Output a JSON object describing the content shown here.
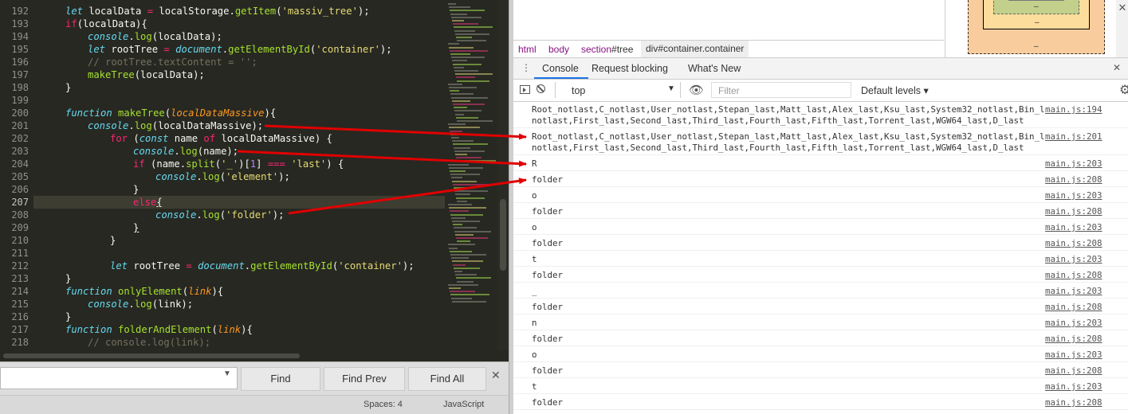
{
  "editor": {
    "line_numbers": [
      "192",
      "193",
      "194",
      "195",
      "196",
      "197",
      "198",
      "199",
      "200",
      "201",
      "202",
      "203",
      "204",
      "205",
      "206",
      "207",
      "208",
      "209",
      "210",
      "211",
      "212",
      "213",
      "214",
      "215",
      "216",
      "217",
      "218"
    ],
    "current_line": "207",
    "find_bar": {
      "input_value": "",
      "find_label": "Find",
      "find_prev_label": "Find Prev",
      "find_all_label": "Find All"
    },
    "status": {
      "spaces": "Spaces: 4",
      "syntax": "JavaScript"
    }
  },
  "devtools": {
    "breadcrumb": [
      {
        "tag": "html",
        "rest": ""
      },
      {
        "tag": "body",
        "rest": ""
      },
      {
        "tag": "section",
        "rest": "#tree"
      },
      {
        "tag": "div",
        "rest": "#container.container"
      }
    ],
    "box_model_dashes": [
      "–",
      "–",
      "–"
    ],
    "drawer_tabs": [
      "Console",
      "Request blocking",
      "What's New"
    ],
    "context": "top",
    "filter_placeholder": "Filter",
    "levels": "Default levels ▾",
    "messages": [
      {
        "text": "Root_notlast,C_notlast,User_notlast,Stepan_last,Matt_last,Alex_last,Ksu_last,System32_notlast,Bin_last,Anchor_notlast,First_last,Second_last,Third_last,Fourth_last,Fifth_last,Torrent_last,WGW64_last,D_last",
        "source": "main.js:194"
      },
      {
        "text": "Root_notlast,C_notlast,User_notlast,Stepan_last,Matt_last,Alex_last,Ksu_last,System32_notlast,Bin_last,Anchor_notlast,First_last,Second_last,Third_last,Fourth_last,Fifth_last,Torrent_last,WGW64_last,D_last",
        "source": "main.js:201"
      },
      {
        "text": "R",
        "source": "main.js:203"
      },
      {
        "text": "folder",
        "source": "main.js:208"
      },
      {
        "text": "o",
        "source": "main.js:203"
      },
      {
        "text": "folder",
        "source": "main.js:208"
      },
      {
        "text": "o",
        "source": "main.js:203"
      },
      {
        "text": "folder",
        "source": "main.js:208"
      },
      {
        "text": "t",
        "source": "main.js:203"
      },
      {
        "text": "folder",
        "source": "main.js:208"
      },
      {
        "text": "_",
        "source": "main.js:203"
      },
      {
        "text": "folder",
        "source": "main.js:208"
      },
      {
        "text": "n",
        "source": "main.js:203"
      },
      {
        "text": "folder",
        "source": "main.js:208"
      },
      {
        "text": "o",
        "source": "main.js:203"
      },
      {
        "text": "folder",
        "source": "main.js:208"
      },
      {
        "text": "t",
        "source": "main.js:203"
      },
      {
        "text": "folder",
        "source": "main.js:208"
      }
    ]
  },
  "colors": {
    "editor_bg": "#272822",
    "keyword": "#f92672",
    "string": "#e6db74",
    "builtin": "#66d9ef",
    "function": "#a6e22e",
    "param": "#fd971f",
    "comment": "#75715e",
    "annotation_arrow": "#e00000",
    "tab_underline": "#1a73e8"
  }
}
